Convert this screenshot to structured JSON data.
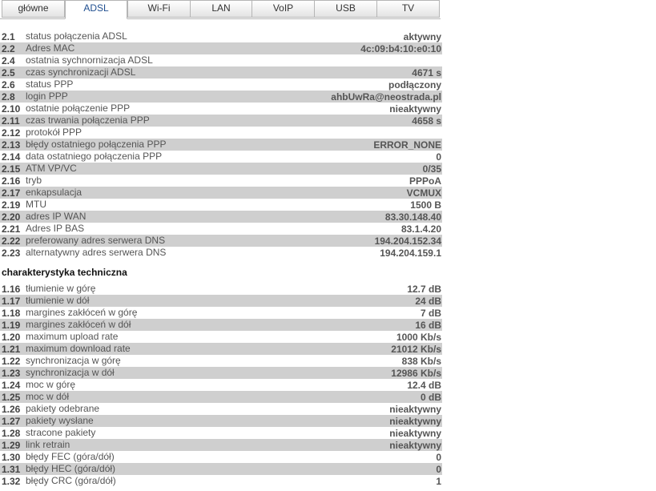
{
  "tabs": [
    {
      "label": "główne",
      "active": false
    },
    {
      "label": "ADSL",
      "active": true
    },
    {
      "label": "Wi-Fi",
      "active": false
    },
    {
      "label": "LAN",
      "active": false
    },
    {
      "label": "VoIP",
      "active": false
    },
    {
      "label": "USB",
      "active": false
    },
    {
      "label": "TV",
      "active": false
    }
  ],
  "adsl": [
    {
      "num": "2.1",
      "label": "status połączenia ADSL",
      "value": "aktywny"
    },
    {
      "num": "2.2",
      "label": "Adres MAC",
      "value": "4c:09:b4:10:e0:10"
    },
    {
      "num": "2.4",
      "label": "ostatnia sychnornizacja ADSL",
      "value": ""
    },
    {
      "num": "2.5",
      "label": "czas synchronizacji ADSL",
      "value": "4671 s"
    },
    {
      "num": "2.6",
      "label": "status PPP",
      "value": "podłączony"
    },
    {
      "num": "2.8",
      "label": "login PPP",
      "value": "ahbUwRa@neostrada.pl"
    },
    {
      "num": "2.10",
      "label": "ostatnie połączenie PPP",
      "value": "nieaktywny"
    },
    {
      "num": "2.11",
      "label": "czas trwania połączenia PPP",
      "value": "4658 s"
    },
    {
      "num": "2.12",
      "label": "protokół PPP",
      "value": ""
    },
    {
      "num": "2.13",
      "label": "błędy ostatniego połączenia PPP",
      "value": "ERROR_NONE"
    },
    {
      "num": "2.14",
      "label": "data ostatniego połączenia PPP",
      "value": "0"
    },
    {
      "num": "2.15",
      "label": "ATM VP/VC",
      "value": "0/35"
    },
    {
      "num": "2.16",
      "label": "tryb",
      "value": "PPPoA"
    },
    {
      "num": "2.17",
      "label": "enkapsulacja",
      "value": "VCMUX"
    },
    {
      "num": "2.19",
      "label": "MTU",
      "value": "1500 B"
    },
    {
      "num": "2.20",
      "label": "adres IP WAN",
      "value": "83.30.148.40"
    },
    {
      "num": "2.21",
      "label": "Adres IP BAS",
      "value": "83.1.4.20"
    },
    {
      "num": "2.22",
      "label": "preferowany adres serwera DNS",
      "value": "194.204.152.34"
    },
    {
      "num": "2.23",
      "label": "alternatywny adres serwera DNS",
      "value": "194.204.159.1"
    }
  ],
  "tech_heading": "charakterystyka techniczna",
  "tech": [
    {
      "num": "1.16",
      "label": "tłumienie w górę",
      "value": "12.7 dB"
    },
    {
      "num": "1.17",
      "label": "tłumienie w dół",
      "value": "24 dB"
    },
    {
      "num": "1.18",
      "label": "margines zakłóceń w górę",
      "value": "7 dB"
    },
    {
      "num": "1.19",
      "label": "margines zakłóceń w dół",
      "value": "16 dB"
    },
    {
      "num": "1.20",
      "label": "maximum upload rate",
      "value": "1000 Kb/s"
    },
    {
      "num": "1.21",
      "label": "maximum download rate",
      "value": "21012 Kb/s"
    },
    {
      "num": "1.22",
      "label": "synchronizacja w górę",
      "value": "838 Kb/s"
    },
    {
      "num": "1.23",
      "label": "synchronizacja w dół",
      "value": "12986 Kb/s"
    },
    {
      "num": "1.24",
      "label": "moc w górę",
      "value": "12.4 dB"
    },
    {
      "num": "1.25",
      "label": "moc w dół",
      "value": "0 dB"
    },
    {
      "num": "1.26",
      "label": "pakiety odebrane",
      "value": "nieaktywny"
    },
    {
      "num": "1.27",
      "label": "pakiety wysłane",
      "value": "nieaktywny"
    },
    {
      "num": "1.28",
      "label": "stracone pakiety",
      "value": "nieaktywny"
    },
    {
      "num": "1.29",
      "label": "link retrain",
      "value": "nieaktywny"
    },
    {
      "num": "1.30",
      "label": "błędy FEC (góra/dół)",
      "value": "0"
    },
    {
      "num": "1.31",
      "label": "błędy HEC (góra/dół)",
      "value": "0"
    },
    {
      "num": "1.32",
      "label": "błędy CRC (góra/dół)",
      "value": "1"
    }
  ]
}
